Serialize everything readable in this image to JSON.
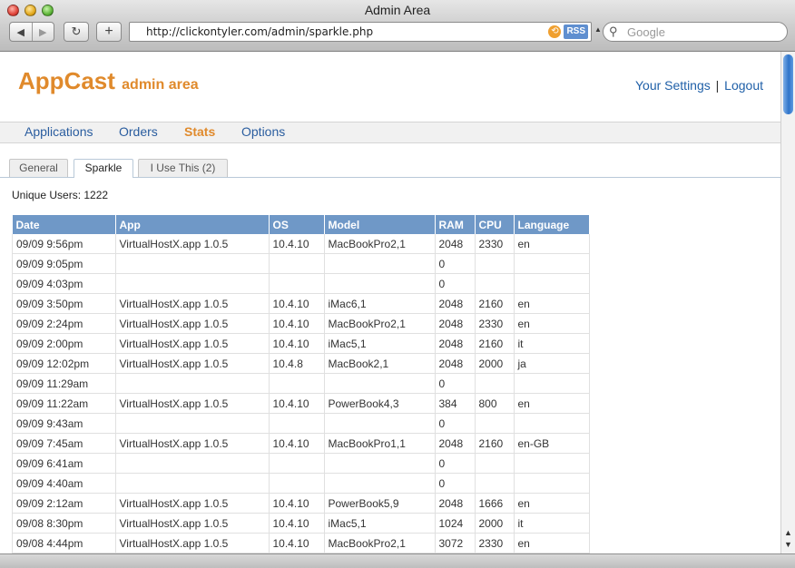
{
  "window": {
    "title": "Admin Area"
  },
  "toolbar": {
    "url": "http://clickontyler.com/admin/sparkle.php",
    "rss_label": "RSS",
    "search_placeholder": "Google",
    "add_bookmark_label": "+"
  },
  "header": {
    "logo_main": "AppCast",
    "logo_sub": "admin area",
    "settings_link": "Your Settings",
    "separator": "|",
    "logout_link": "Logout"
  },
  "nav": {
    "items": [
      {
        "label": "Applications",
        "active": false
      },
      {
        "label": "Orders",
        "active": false
      },
      {
        "label": "Stats",
        "active": true
      },
      {
        "label": "Options",
        "active": false
      }
    ]
  },
  "tabs": {
    "items": [
      {
        "label": "General",
        "active": false
      },
      {
        "label": "Sparkle",
        "active": true
      },
      {
        "label": "I Use This (2)",
        "active": false
      }
    ]
  },
  "summary": {
    "unique_users": "Unique Users: 1222"
  },
  "table": {
    "headers": [
      "Date",
      "App",
      "OS",
      "Model",
      "RAM",
      "CPU",
      "Language"
    ],
    "rows": [
      [
        "09/09 9:56pm",
        "VirtualHostX.app 1.0.5",
        "10.4.10",
        "MacBookPro2,1",
        "2048",
        "2330",
        "en"
      ],
      [
        "09/09 9:05pm",
        "",
        "",
        "",
        "0",
        "",
        ""
      ],
      [
        "09/09 4:03pm",
        "",
        "",
        "",
        "0",
        "",
        ""
      ],
      [
        "09/09 3:50pm",
        "VirtualHostX.app 1.0.5",
        "10.4.10",
        "iMac6,1",
        "2048",
        "2160",
        "en"
      ],
      [
        "09/09 2:24pm",
        "VirtualHostX.app 1.0.5",
        "10.4.10",
        "MacBookPro2,1",
        "2048",
        "2330",
        "en"
      ],
      [
        "09/09 2:00pm",
        "VirtualHostX.app 1.0.5",
        "10.4.10",
        "iMac5,1",
        "2048",
        "2160",
        "it"
      ],
      [
        "09/09 12:02pm",
        "VirtualHostX.app 1.0.5",
        "10.4.8",
        "MacBook2,1",
        "2048",
        "2000",
        "ja"
      ],
      [
        "09/09 11:29am",
        "",
        "",
        "",
        "0",
        "",
        ""
      ],
      [
        "09/09 11:22am",
        "VirtualHostX.app 1.0.5",
        "10.4.10",
        "PowerBook4,3",
        "384",
        "800",
        "en"
      ],
      [
        "09/09 9:43am",
        "",
        "",
        "",
        "0",
        "",
        ""
      ],
      [
        "09/09 7:45am",
        "VirtualHostX.app 1.0.5",
        "10.4.10",
        "MacBookPro1,1",
        "2048",
        "2160",
        "en-GB"
      ],
      [
        "09/09 6:41am",
        "",
        "",
        "",
        "0",
        "",
        ""
      ],
      [
        "09/09 4:40am",
        "",
        "",
        "",
        "0",
        "",
        ""
      ],
      [
        "09/09 2:12am",
        "VirtualHostX.app 1.0.5",
        "10.4.10",
        "PowerBook5,9",
        "2048",
        "1666",
        "en"
      ],
      [
        "09/08 8:30pm",
        "VirtualHostX.app 1.0.5",
        "10.4.10",
        "iMac5,1",
        "1024",
        "2000",
        "it"
      ],
      [
        "09/08 4:44pm",
        "VirtualHostX.app 1.0.5",
        "10.4.10",
        "MacBookPro2,1",
        "3072",
        "2330",
        "en"
      ]
    ]
  },
  "colors": {
    "accent": "#e08a2c",
    "link": "#2a5d9f",
    "table_header": "#6f98c7"
  }
}
